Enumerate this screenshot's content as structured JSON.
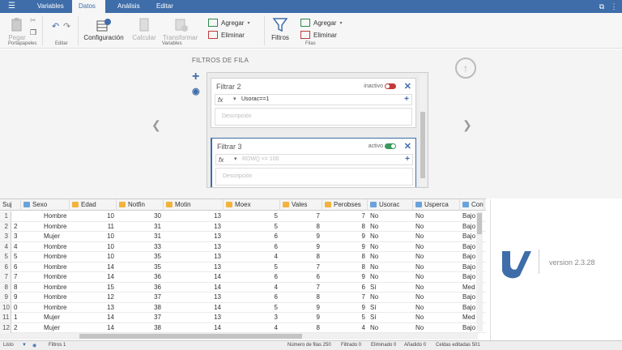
{
  "tabs": [
    {
      "label": "Variables",
      "active": false
    },
    {
      "label": "Datos",
      "active": true
    },
    {
      "label": "Análisis",
      "active": false
    },
    {
      "label": "Editar",
      "active": false
    }
  ],
  "ribbon": {
    "pegar": "Pegar",
    "portapapeles": "Portapapeles",
    "editar": "Editar",
    "configuracion": "Configuración",
    "calcular": "Calcular",
    "transformar": "Transformar",
    "variables_group": "Variables",
    "agregar": "Agregar",
    "eliminar": "Eliminar",
    "filtros": "Filtros",
    "filas_agregar": "Agregar",
    "filas_eliminar": "Eliminar",
    "filas_group": "Filas"
  },
  "filters": {
    "title": "FILTROS DE FILA",
    "items": [
      {
        "name": "Filtrar 2",
        "state": "inactivo",
        "active": false,
        "formula": "Usorac==1",
        "description_placeholder": "Descripción"
      },
      {
        "name": "Filtrar 3",
        "state": "activo",
        "active": true,
        "formula": "ROW() <= 100",
        "description_placeholder": "Descripción"
      }
    ]
  },
  "grid": {
    "columns": [
      {
        "label": "Suj",
        "type": "none"
      },
      {
        "label": "Sexo",
        "type": "nom"
      },
      {
        "label": "Edad",
        "type": "ord"
      },
      {
        "label": "Notfin",
        "type": "ord"
      },
      {
        "label": "Motin",
        "type": "ord"
      },
      {
        "label": "Moex",
        "type": "ord"
      },
      {
        "label": "Vales",
        "type": "ord"
      },
      {
        "label": "Perobses",
        "type": "ord"
      },
      {
        "label": "Usorac",
        "type": "nom"
      },
      {
        "label": "Usperca",
        "type": "nom"
      },
      {
        "label": "Con",
        "type": "nom"
      }
    ],
    "rows": [
      {
        "rn": "1",
        "suj": "",
        "cells": [
          "Hombre",
          "10",
          "30",
          "13",
          "5",
          "7",
          "7",
          "No",
          "No",
          "Bajo"
        ]
      },
      {
        "rn": "2",
        "suj": "2",
        "cells": [
          "Hombre",
          "11",
          "31",
          "13",
          "5",
          "8",
          "8",
          "No",
          "No",
          "Bajo"
        ]
      },
      {
        "rn": "3",
        "suj": "3",
        "cells": [
          "Mujer",
          "10",
          "31",
          "13",
          "6",
          "9",
          "9",
          "No",
          "No",
          "Bajo"
        ]
      },
      {
        "rn": "4",
        "suj": "4",
        "cells": [
          "Hombre",
          "10",
          "33",
          "13",
          "6",
          "9",
          "9",
          "No",
          "No",
          "Bajo"
        ]
      },
      {
        "rn": "5",
        "suj": "5",
        "cells": [
          "Hombre",
          "10",
          "35",
          "13",
          "4",
          "8",
          "8",
          "No",
          "No",
          "Bajo"
        ]
      },
      {
        "rn": "6",
        "suj": "6",
        "cells": [
          "Hombre",
          "14",
          "35",
          "13",
          "5",
          "7",
          "8",
          "No",
          "No",
          "Bajo"
        ]
      },
      {
        "rn": "7",
        "suj": "7",
        "cells": [
          "Hombre",
          "14",
          "36",
          "14",
          "6",
          "6",
          "9",
          "No",
          "No",
          "Bajo"
        ]
      },
      {
        "rn": "8",
        "suj": "8",
        "cells": [
          "Hombre",
          "15",
          "36",
          "14",
          "4",
          "7",
          "6",
          "Sí",
          "No",
          "Med"
        ]
      },
      {
        "rn": "9",
        "suj": "9",
        "cells": [
          "Hombre",
          "12",
          "37",
          "13",
          "6",
          "8",
          "7",
          "No",
          "No",
          "Bajo"
        ]
      },
      {
        "rn": "10",
        "suj": "0",
        "cells": [
          "Hombre",
          "13",
          "38",
          "14",
          "5",
          "9",
          "9",
          "Sí",
          "No",
          "Bajo"
        ]
      },
      {
        "rn": "11",
        "suj": "1",
        "cells": [
          "Mujer",
          "14",
          "37",
          "13",
          "3",
          "9",
          "5",
          "Sí",
          "No",
          "Med"
        ]
      },
      {
        "rn": "12",
        "suj": "2",
        "cells": [
          "Mujer",
          "14",
          "38",
          "14",
          "4",
          "8",
          "4",
          "No",
          "No",
          "Bajo"
        ]
      }
    ]
  },
  "results": {
    "version": "version 2.3.28"
  },
  "status": {
    "ready": "Listo",
    "filters": "Filtros 1",
    "rows": "Número de filas 250",
    "filtered": "Filtrado 0",
    "deleted": "Eliminado 0",
    "added": "Añadido 0",
    "edited": "Celdas editadas 501"
  },
  "colors": {
    "accent": "#3e6da9",
    "active_toggle": "#3a9a5b",
    "inactive_toggle": "#c23b3b"
  }
}
